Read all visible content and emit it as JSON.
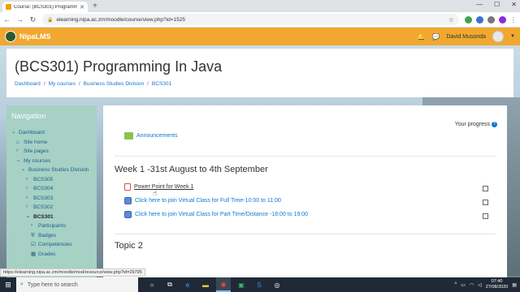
{
  "browser": {
    "tab_title": "Course: (BCS301) Programming In...",
    "new_tab": "+",
    "url": "elearning.nipa.ac.zm/moodle/course/view.php?id=1525",
    "status_url": "https://elearning.nipa.ac.zm/moodle/mod/resource/view.php?id=29795"
  },
  "navbar": {
    "brand": "NipaLMS",
    "user_name": "David Musonda"
  },
  "header": {
    "course_title": "(BCS301) Programming In Java",
    "breadcrumbs": [
      "Dashboard",
      "My courses",
      "Business Studies Division",
      "BCS301"
    ]
  },
  "navigation": {
    "title": "Navigation",
    "items": [
      {
        "label": "Dashboard",
        "icon": "chevron-down-icon"
      },
      {
        "label": "Site home",
        "icon": "home-icon"
      },
      {
        "label": "Site pages",
        "icon": "chevron-right-icon"
      },
      {
        "label": "My courses",
        "icon": "chevron-down-icon"
      },
      {
        "label": "Business Studies Division",
        "icon": "chevron-down-icon"
      },
      {
        "label": "BCS305",
        "icon": "chevron-right-icon"
      },
      {
        "label": "BCS304",
        "icon": "chevron-right-icon"
      },
      {
        "label": "BCS303",
        "icon": "chevron-right-icon"
      },
      {
        "label": "BCS302",
        "icon": "chevron-right-icon"
      },
      {
        "label": "BCS301",
        "icon": "chevron-down-icon"
      },
      {
        "label": "Participants",
        "icon": "chevron-right-icon"
      },
      {
        "label": "Badges",
        "icon": "shield-icon"
      },
      {
        "label": "Competencies",
        "icon": "check-square-icon"
      },
      {
        "label": "Grades",
        "icon": "table-icon"
      }
    ]
  },
  "main": {
    "progress_label": "Your progress",
    "help_symbol": "?",
    "announcements": "Announcements",
    "section1_title": "Week 1 -31st August to 4th September",
    "activities": [
      {
        "label": "Power Point for Week 1",
        "icon": "powerpoint-file-icon"
      },
      {
        "label": "Click here to join Virtual Class for Full Time-10:00 to 11:00",
        "icon": "url-link-icon"
      },
      {
        "label": "Click here to join Virtual Class for Part Time/Distance -18:00 to 19:00",
        "icon": "url-link-icon"
      }
    ],
    "section2_title": "Topic 2"
  },
  "taskbar": {
    "search_placeholder": "Type here to search",
    "time": "07:40",
    "date": "27/08/2020"
  },
  "colors": {
    "navbar": "#f0a830",
    "nav_block": "#a6d1c4",
    "link": "#1177d1"
  }
}
